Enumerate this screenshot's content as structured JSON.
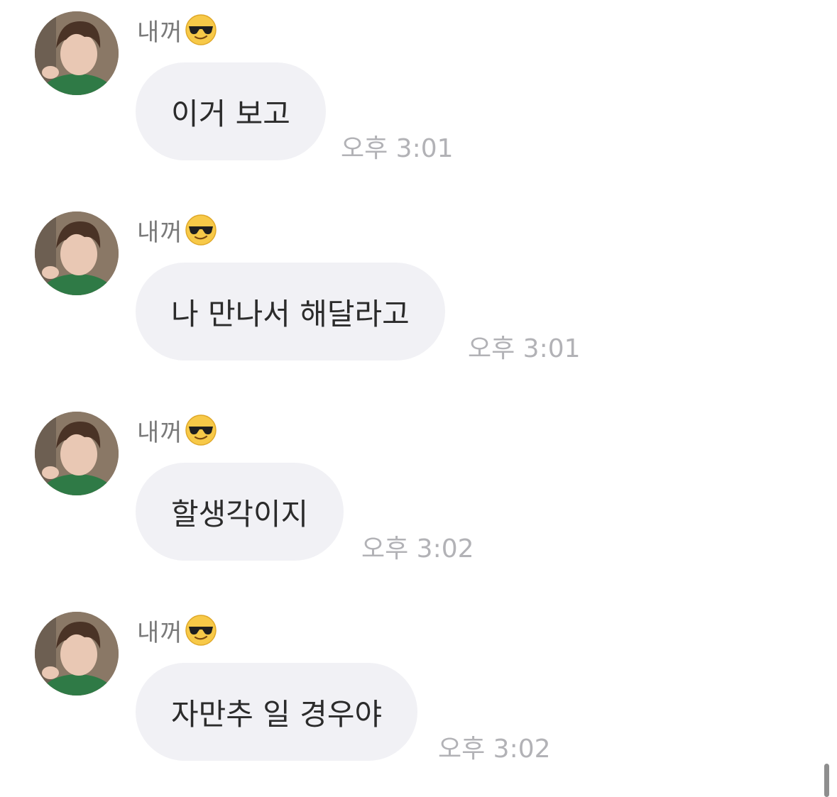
{
  "messages": [
    {
      "sender": "내꺼",
      "sender_emoji": "sunglasses-face-emoji",
      "text": "이거 보고",
      "time": "오후 3:01"
    },
    {
      "sender": "내꺼",
      "sender_emoji": "sunglasses-face-emoji",
      "text": "나 만나서 해달라고",
      "time": "오후 3:01"
    },
    {
      "sender": "내꺼",
      "sender_emoji": "sunglasses-face-emoji",
      "text": "할생각이지",
      "time": "오후 3:02"
    },
    {
      "sender": "내꺼",
      "sender_emoji": "sunglasses-face-emoji",
      "text": "자만추 일 경우야",
      "time": "오후 3:02"
    }
  ],
  "colors": {
    "bubble": "#f1f1f5",
    "message_text": "#2b2b2b",
    "sender_text": "#7a7a7a",
    "time_text": "#b2b2b6"
  }
}
